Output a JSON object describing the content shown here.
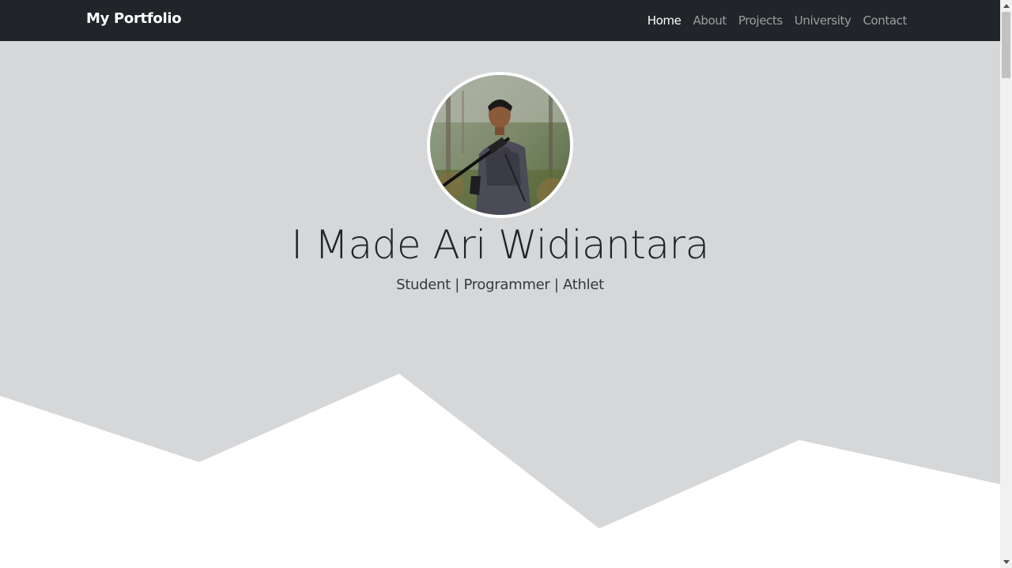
{
  "navbar": {
    "brand": "My Portfolio",
    "links": [
      {
        "label": "Home",
        "active": true
      },
      {
        "label": "About",
        "active": false
      },
      {
        "label": "Projects",
        "active": false
      },
      {
        "label": "University",
        "active": false
      },
      {
        "label": "Contact",
        "active": false
      }
    ]
  },
  "hero": {
    "name": "I Made Ari Widiantara",
    "tagline": "Student | Programmer | Athlet",
    "avatar_icon": "profile-photo"
  },
  "colors": {
    "navbar_bg": "#212529",
    "hero_bg": "#d6d7d9",
    "nav_active": "#ffffff",
    "nav_inactive": "rgba(255,255,255,0.55)"
  }
}
